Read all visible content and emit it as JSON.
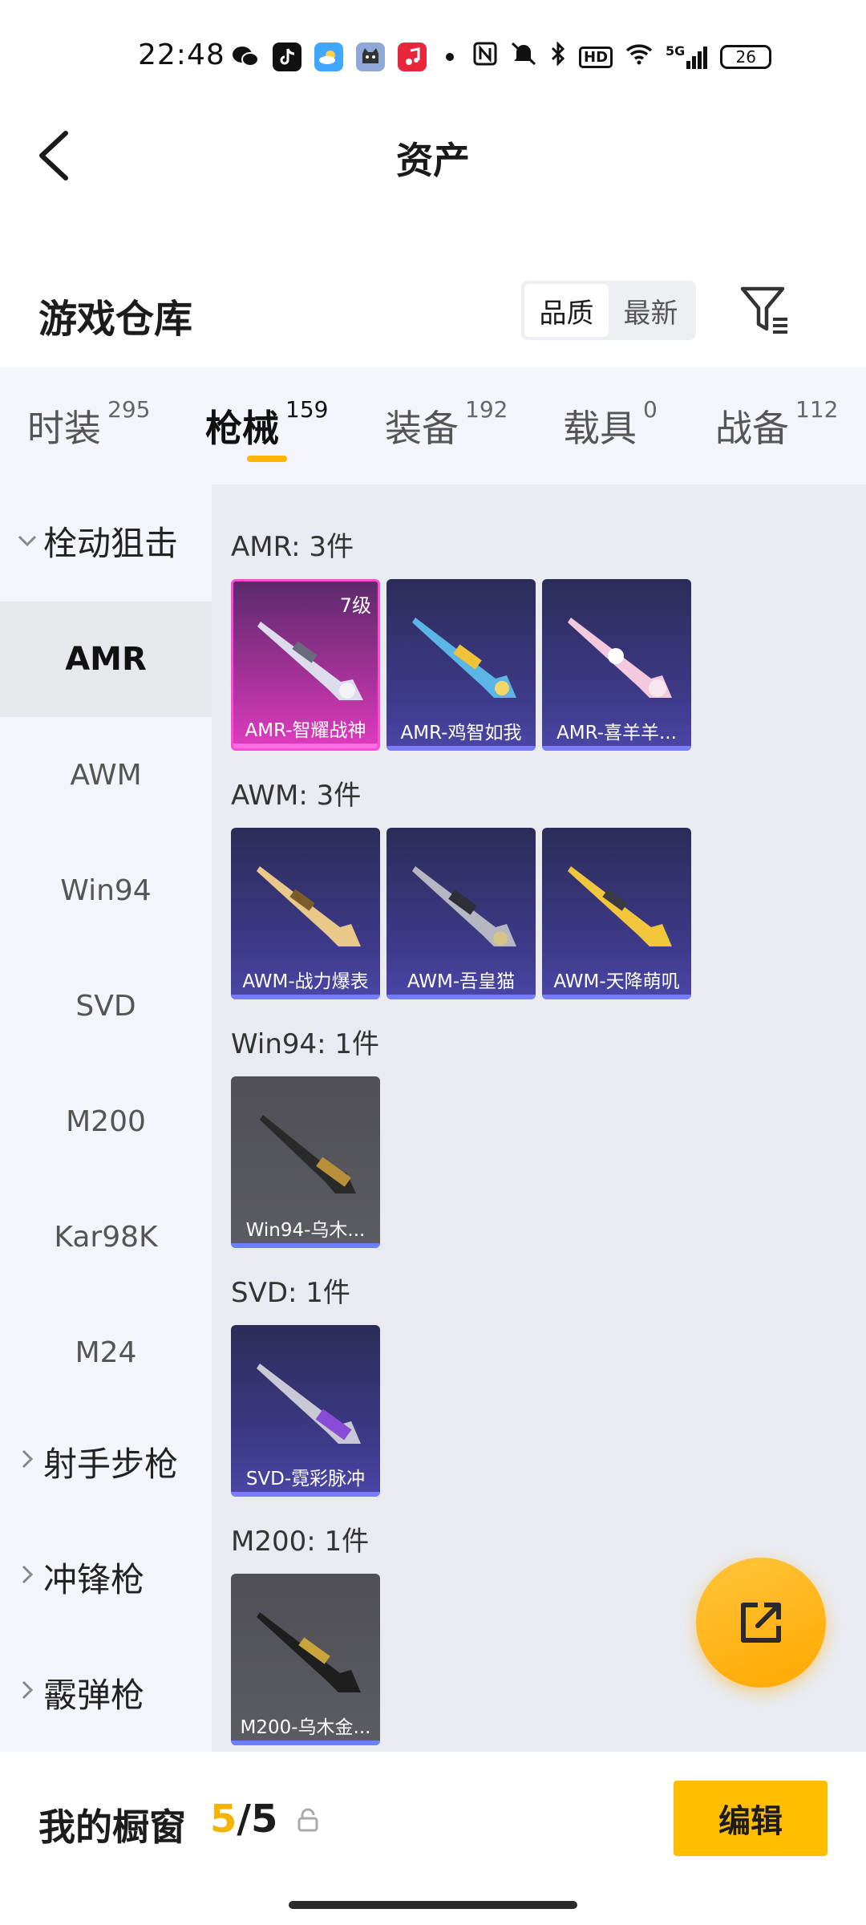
{
  "status_bar": {
    "time": "22:48",
    "icons": [
      "wechat-icon",
      "tiktok-icon",
      "weather-icon",
      "cat-app-icon",
      "music-icon",
      "nfc-icon",
      "mute-icon",
      "bluetooth-icon",
      "hd-icon",
      "wifi-icon",
      "signal-5g-icon"
    ],
    "signal_label": "5G",
    "hd_label": "HD",
    "battery": "26"
  },
  "nav": {
    "title": "资产"
  },
  "warehouse": {
    "title": "游戏仓库",
    "sort_options": [
      "品质",
      "最新"
    ],
    "selected_sort": "品质"
  },
  "tabs": [
    {
      "label": "时装",
      "count": "295"
    },
    {
      "label": "枪械",
      "count": "159",
      "active": true
    },
    {
      "label": "装备",
      "count": "192"
    },
    {
      "label": "载具",
      "count": "0"
    },
    {
      "label": "战备",
      "count": "112"
    }
  ],
  "sidebar": {
    "categories": [
      {
        "label": "栓动狙击",
        "expanded": true
      },
      {
        "label": "射手步枪"
      },
      {
        "label": "冲锋枪"
      },
      {
        "label": "霰弹枪"
      }
    ],
    "items": [
      "AMR",
      "AWM",
      "Win94",
      "SVD",
      "M200",
      "Kar98K",
      "M24"
    ],
    "selected_item": "AMR"
  },
  "groups": [
    {
      "title": "AMR: 3件",
      "items": [
        {
          "name": "AMR-智耀战神",
          "level": "7级",
          "quality": "pink"
        },
        {
          "name": "AMR-鸡智如我",
          "quality": "purple"
        },
        {
          "name": "AMR-喜羊羊...",
          "quality": "purple"
        }
      ]
    },
    {
      "title": "AWM: 3件",
      "items": [
        {
          "name": "AWM-战力爆表",
          "quality": "purple"
        },
        {
          "name": "AWM-吾皇猫",
          "quality": "purple"
        },
        {
          "name": "AWM-天降萌叽",
          "quality": "purple"
        }
      ]
    },
    {
      "title": "Win94: 1件",
      "items": [
        {
          "name": "Win94-乌木...",
          "quality": "gray"
        }
      ]
    },
    {
      "title": "SVD: 1件",
      "items": [
        {
          "name": "SVD-霓彩脉冲",
          "quality": "purple"
        }
      ]
    },
    {
      "title": "M200: 1件",
      "items": [
        {
          "name": "M200-乌木金...",
          "quality": "gray"
        }
      ]
    }
  ],
  "bottom": {
    "label": "我的橱窗",
    "current": "5",
    "separator": "/",
    "total": "5",
    "edit_label": "编辑"
  },
  "colors": {
    "accent": "#ffbe00",
    "tab_underline": "#ffb400",
    "purple_card": "#3e3a8a",
    "pink_card": "#e03bbf",
    "gray_card": "#55555b"
  }
}
